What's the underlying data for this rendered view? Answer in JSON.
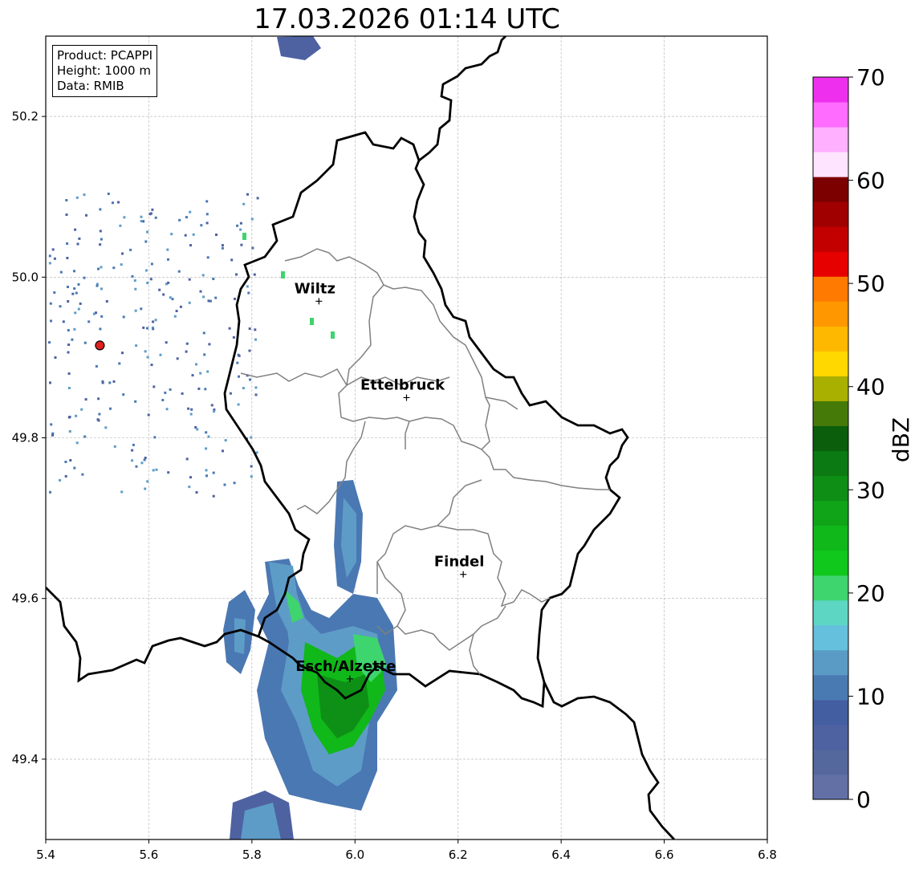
{
  "title": "17.03.2026 01:14 UTC",
  "info": {
    "product": "Product: PCAPPI",
    "height": "Height: 1000 m",
    "data": "Data: RMIB"
  },
  "axes": {
    "x_range": [
      5.4,
      6.8
    ],
    "y_range": [
      49.3,
      50.3
    ],
    "x_ticks": [
      "5.4",
      "5.6",
      "5.8",
      "6.0",
      "6.2",
      "6.4",
      "6.6",
      "6.8"
    ],
    "y_ticks": [
      "49.4",
      "49.6",
      "49.8",
      "50.0",
      "50.2"
    ],
    "grid": true
  },
  "cities": [
    {
      "name": "Wiltz",
      "lon": 5.93,
      "lat": 49.97
    },
    {
      "name": "Ettelbruck",
      "lon": 6.1,
      "lat": 49.85
    },
    {
      "name": "Findel",
      "lon": 6.21,
      "lat": 49.63
    },
    {
      "name": "Esch/Alzette",
      "lon": 5.99,
      "lat": 49.5
    }
  ],
  "radar_site": {
    "lon": 5.505,
    "lat": 49.915,
    "color": "#e02020"
  },
  "colorbar": {
    "label": "dBZ",
    "min": 0,
    "max": 70,
    "tick_labels": [
      "0",
      "10",
      "20",
      "30",
      "40",
      "50",
      "60",
      "70"
    ],
    "colors": [
      "#6270a6",
      "#54689e",
      "#4e62a2",
      "#445ea2",
      "#4a7ab2",
      "#5a9bc6",
      "#64c0dc",
      "#5ed6c4",
      "#3ed46e",
      "#10c81c",
      "#10b81a",
      "#10a418",
      "#0e8e14",
      "#0c7a12",
      "#0a5e0c",
      "#467a08",
      "#aab000",
      "#ffd800",
      "#ffb800",
      "#ff9800",
      "#ff7a00",
      "#e60000",
      "#c20000",
      "#a00000",
      "#7c0000",
      "#ffe4ff",
      "#ffb0ff",
      "#ff6cff",
      "#ee30ee"
    ]
  }
}
